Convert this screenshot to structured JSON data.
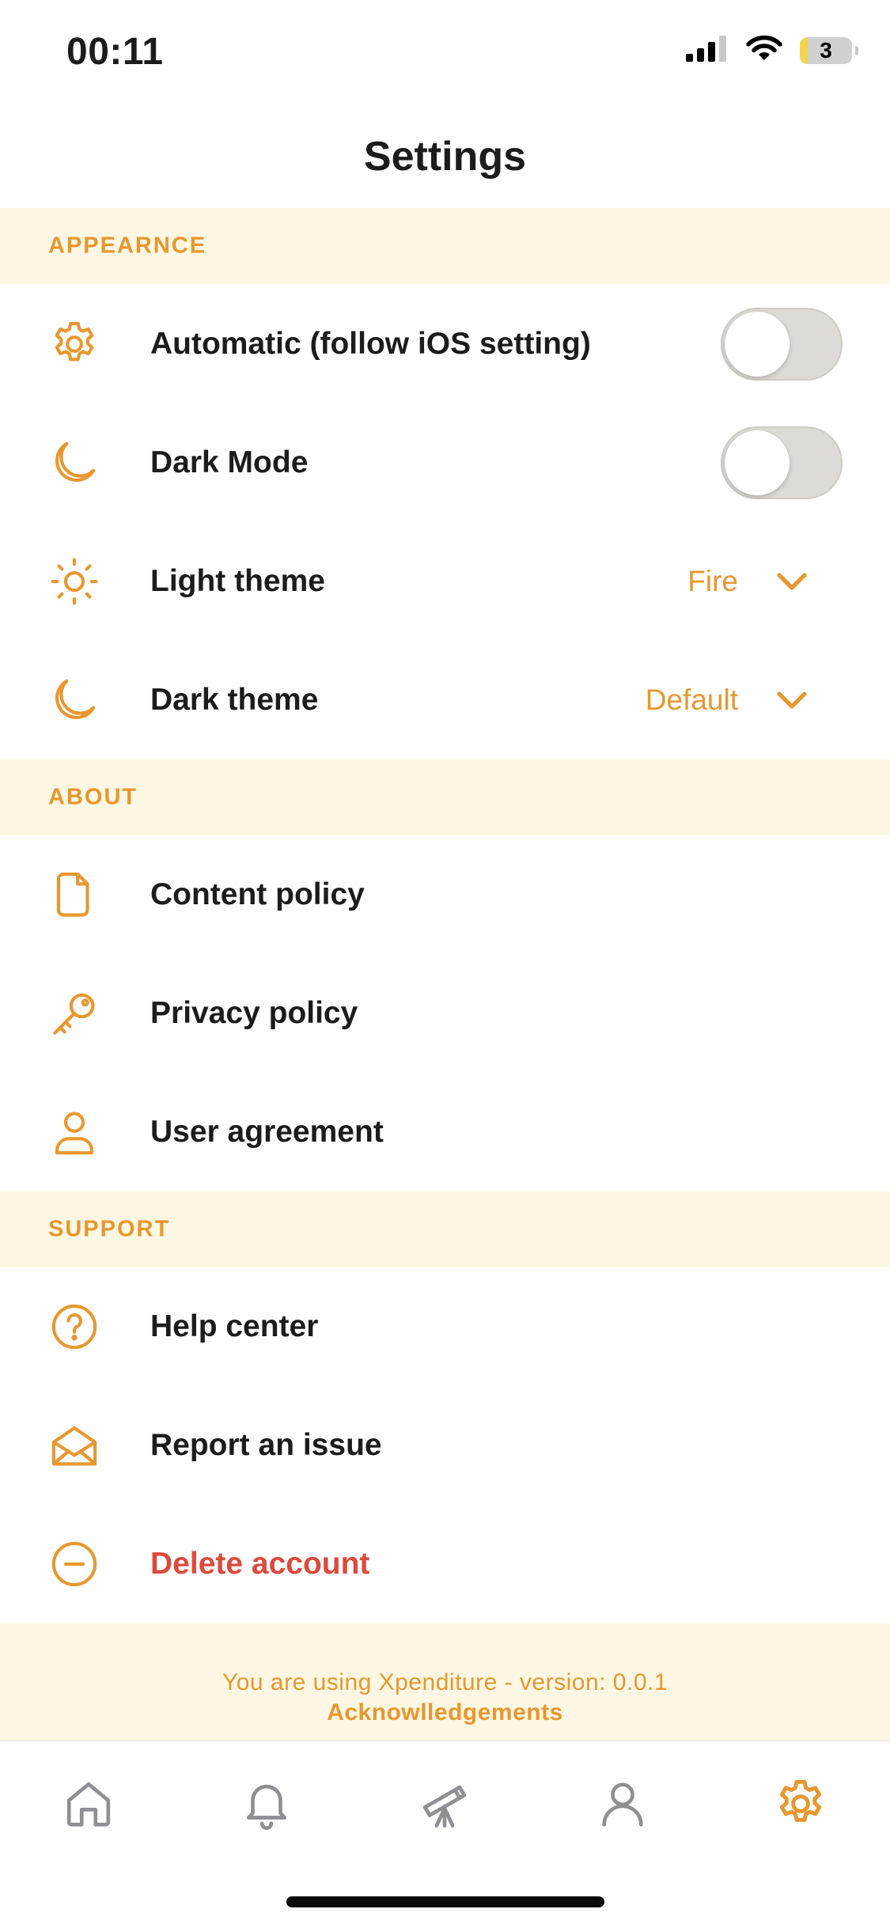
{
  "status_bar": {
    "time": "00:11",
    "battery": "3"
  },
  "header": {
    "title": "Settings"
  },
  "sections": {
    "appearance": {
      "title": "APPEARNCE",
      "rows": {
        "automatic": {
          "label": "Automatic (follow iOS setting)",
          "icon": "gear-icon",
          "toggle": false
        },
        "dark_mode": {
          "label": "Dark Mode",
          "icon": "moon-icon",
          "toggle": false
        },
        "light_theme": {
          "label": "Light theme",
          "icon": "sun-icon",
          "value": "Fire"
        },
        "dark_theme": {
          "label": "Dark theme",
          "icon": "moon-icon",
          "value": "Default"
        }
      }
    },
    "about": {
      "title": "ABOUT",
      "rows": {
        "content_policy": {
          "label": "Content policy",
          "icon": "document-icon"
        },
        "privacy_policy": {
          "label": "Privacy policy",
          "icon": "key-icon"
        },
        "user_agreement": {
          "label": "User agreement",
          "icon": "user-icon"
        }
      }
    },
    "support": {
      "title": "SUPPORT",
      "rows": {
        "help_center": {
          "label": "Help center",
          "icon": "question-circle-icon"
        },
        "report_issue": {
          "label": "Report an issue",
          "icon": "envelope-open-icon"
        },
        "delete_account": {
          "label": "Delete account",
          "icon": "minus-circle-icon"
        }
      }
    }
  },
  "footer": {
    "version_text": "You are using Xpenditure - version: 0.0.1",
    "link_text": "Acknowlledgements"
  },
  "tab_bar": {
    "items": [
      {
        "icon": "home-icon",
        "active": false
      },
      {
        "icon": "bell-icon",
        "active": false
      },
      {
        "icon": "telescope-icon",
        "active": false
      },
      {
        "icon": "person-icon",
        "active": false
      },
      {
        "icon": "gear-icon",
        "active": true
      }
    ]
  },
  "colors": {
    "accent": "#e8972e",
    "section_background": "#fdf7e3",
    "danger": "#dc4a3c",
    "text": "#1c1c1e",
    "inactive_tab": "#8e8e93"
  }
}
